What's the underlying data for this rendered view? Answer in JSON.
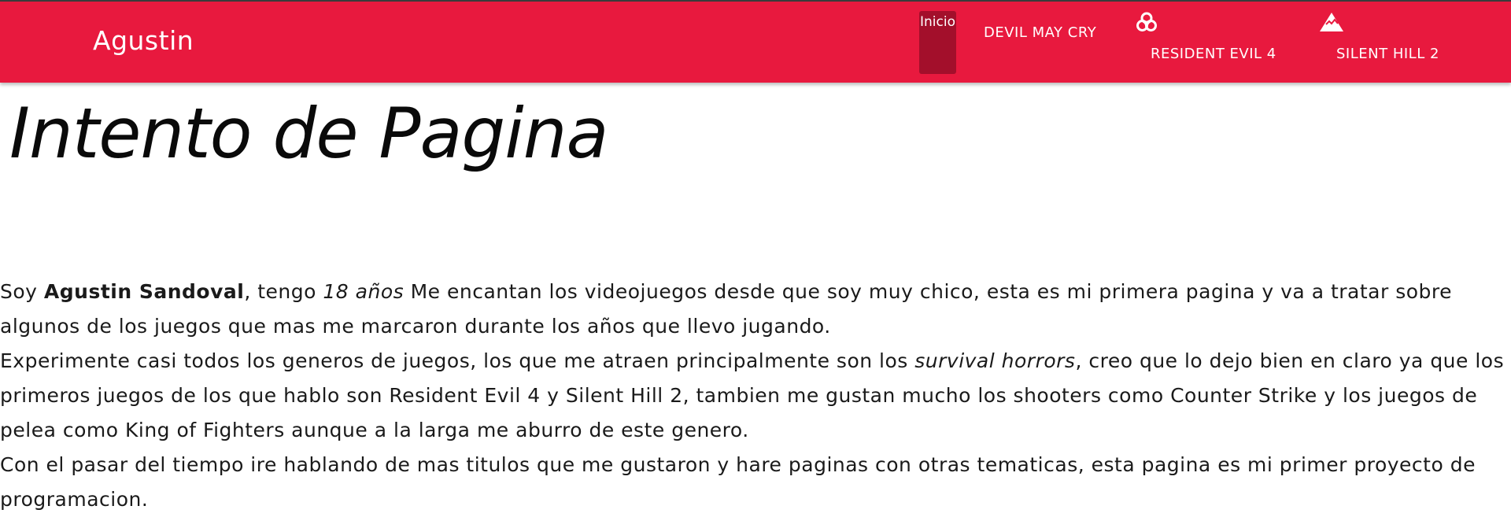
{
  "navbar": {
    "brand": "Agustin",
    "home_label": "Inicio",
    "links": {
      "devil_may_cry": "DEVIL MAY CRY",
      "resident_evil_4": "RESIDENT EVIL 4",
      "silent_hill_2": "SILENT HILL 2"
    },
    "icons": {
      "resident_evil_4": "biohazard-icon",
      "silent_hill_2": "mountain-icon"
    },
    "colors": {
      "background": "#e8193e",
      "active": "#a30f2b",
      "text": "#ffffff"
    }
  },
  "main": {
    "title": "Intento de Pagina",
    "p1": {
      "t1": "Soy ",
      "name": "Agustin Sandoval",
      "t2": ", tengo ",
      "age": "18 años",
      "t3": " Me encantan los videojuegos desde que soy muy chico, esta es mi primera pagina y va a tratar sobre algunos de los juegos que mas me marcaron durante los años que llevo jugando."
    },
    "p2": {
      "t1": "Experimente casi todos los generos de juegos, los que me atraen principalmente son los ",
      "genre": "survival horrors",
      "t2": ", creo que lo dejo bien en claro ya que los primeros juegos de los que hablo son Resident Evil 4 y Silent Hill 2, tambien me gustan mucho los shooters como Counter Strike y los juegos de pelea como King of Fighters aunque a la larga me aburro de este genero."
    },
    "p3": {
      "text": "Con el pasar del tiempo ire hablando de mas titulos que me gustaron y hare paginas con otras tematicas, esta pagina es mi primer proyecto de programacion."
    }
  }
}
